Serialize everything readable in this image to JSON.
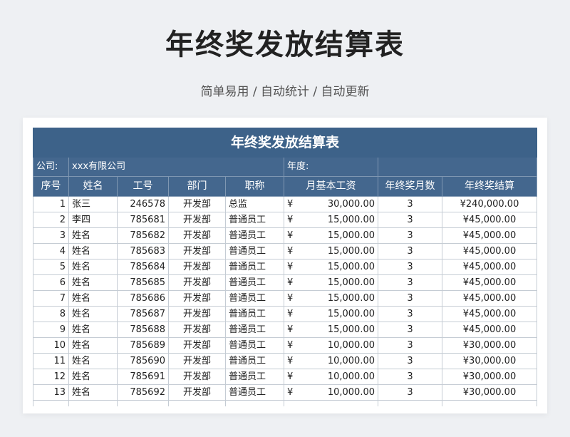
{
  "hero": {
    "title": "年终奖发放结算表",
    "subtitle": "简单易用 / 自动统计 / 自动更新"
  },
  "sheet": {
    "title": "年终奖发放结算表",
    "company_label": "公司:",
    "company_value": "xxx有限公司",
    "year_label": "年度:",
    "headers": [
      "序号",
      "姓名",
      "工号",
      "部门",
      "职称",
      "月基本工资",
      "年终奖月数",
      "年终奖结算"
    ],
    "currency": "¥",
    "rows": [
      {
        "no": "1",
        "name": "张三",
        "id": "246578",
        "dept": "开发部",
        "title": "总监",
        "salary": "30,000.00",
        "months": "3",
        "bonus": "¥240,000.00"
      },
      {
        "no": "2",
        "name": "李四",
        "id": "785681",
        "dept": "开发部",
        "title": "普通员工",
        "salary": "15,000.00",
        "months": "3",
        "bonus": "¥45,000.00"
      },
      {
        "no": "3",
        "name": "姓名",
        "id": "785682",
        "dept": "开发部",
        "title": "普通员工",
        "salary": "15,000.00",
        "months": "3",
        "bonus": "¥45,000.00"
      },
      {
        "no": "4",
        "name": "姓名",
        "id": "785683",
        "dept": "开发部",
        "title": "普通员工",
        "salary": "15,000.00",
        "months": "3",
        "bonus": "¥45,000.00"
      },
      {
        "no": "5",
        "name": "姓名",
        "id": "785684",
        "dept": "开发部",
        "title": "普通员工",
        "salary": "15,000.00",
        "months": "3",
        "bonus": "¥45,000.00"
      },
      {
        "no": "6",
        "name": "姓名",
        "id": "785685",
        "dept": "开发部",
        "title": "普通员工",
        "salary": "15,000.00",
        "months": "3",
        "bonus": "¥45,000.00"
      },
      {
        "no": "7",
        "name": "姓名",
        "id": "785686",
        "dept": "开发部",
        "title": "普通员工",
        "salary": "15,000.00",
        "months": "3",
        "bonus": "¥45,000.00"
      },
      {
        "no": "8",
        "name": "姓名",
        "id": "785687",
        "dept": "开发部",
        "title": "普通员工",
        "salary": "15,000.00",
        "months": "3",
        "bonus": "¥45,000.00"
      },
      {
        "no": "9",
        "name": "姓名",
        "id": "785688",
        "dept": "开发部",
        "title": "普通员工",
        "salary": "15,000.00",
        "months": "3",
        "bonus": "¥45,000.00"
      },
      {
        "no": "10",
        "name": "姓名",
        "id": "785689",
        "dept": "开发部",
        "title": "普通员工",
        "salary": "10,000.00",
        "months": "3",
        "bonus": "¥30,000.00"
      },
      {
        "no": "11",
        "name": "姓名",
        "id": "785690",
        "dept": "开发部",
        "title": "普通员工",
        "salary": "10,000.00",
        "months": "3",
        "bonus": "¥30,000.00"
      },
      {
        "no": "12",
        "name": "姓名",
        "id": "785691",
        "dept": "开发部",
        "title": "普通员工",
        "salary": "10,000.00",
        "months": "3",
        "bonus": "¥30,000.00"
      },
      {
        "no": "13",
        "name": "姓名",
        "id": "785692",
        "dept": "开发部",
        "title": "普通员工",
        "salary": "10,000.00",
        "months": "3",
        "bonus": "¥30,000.00"
      }
    ]
  }
}
